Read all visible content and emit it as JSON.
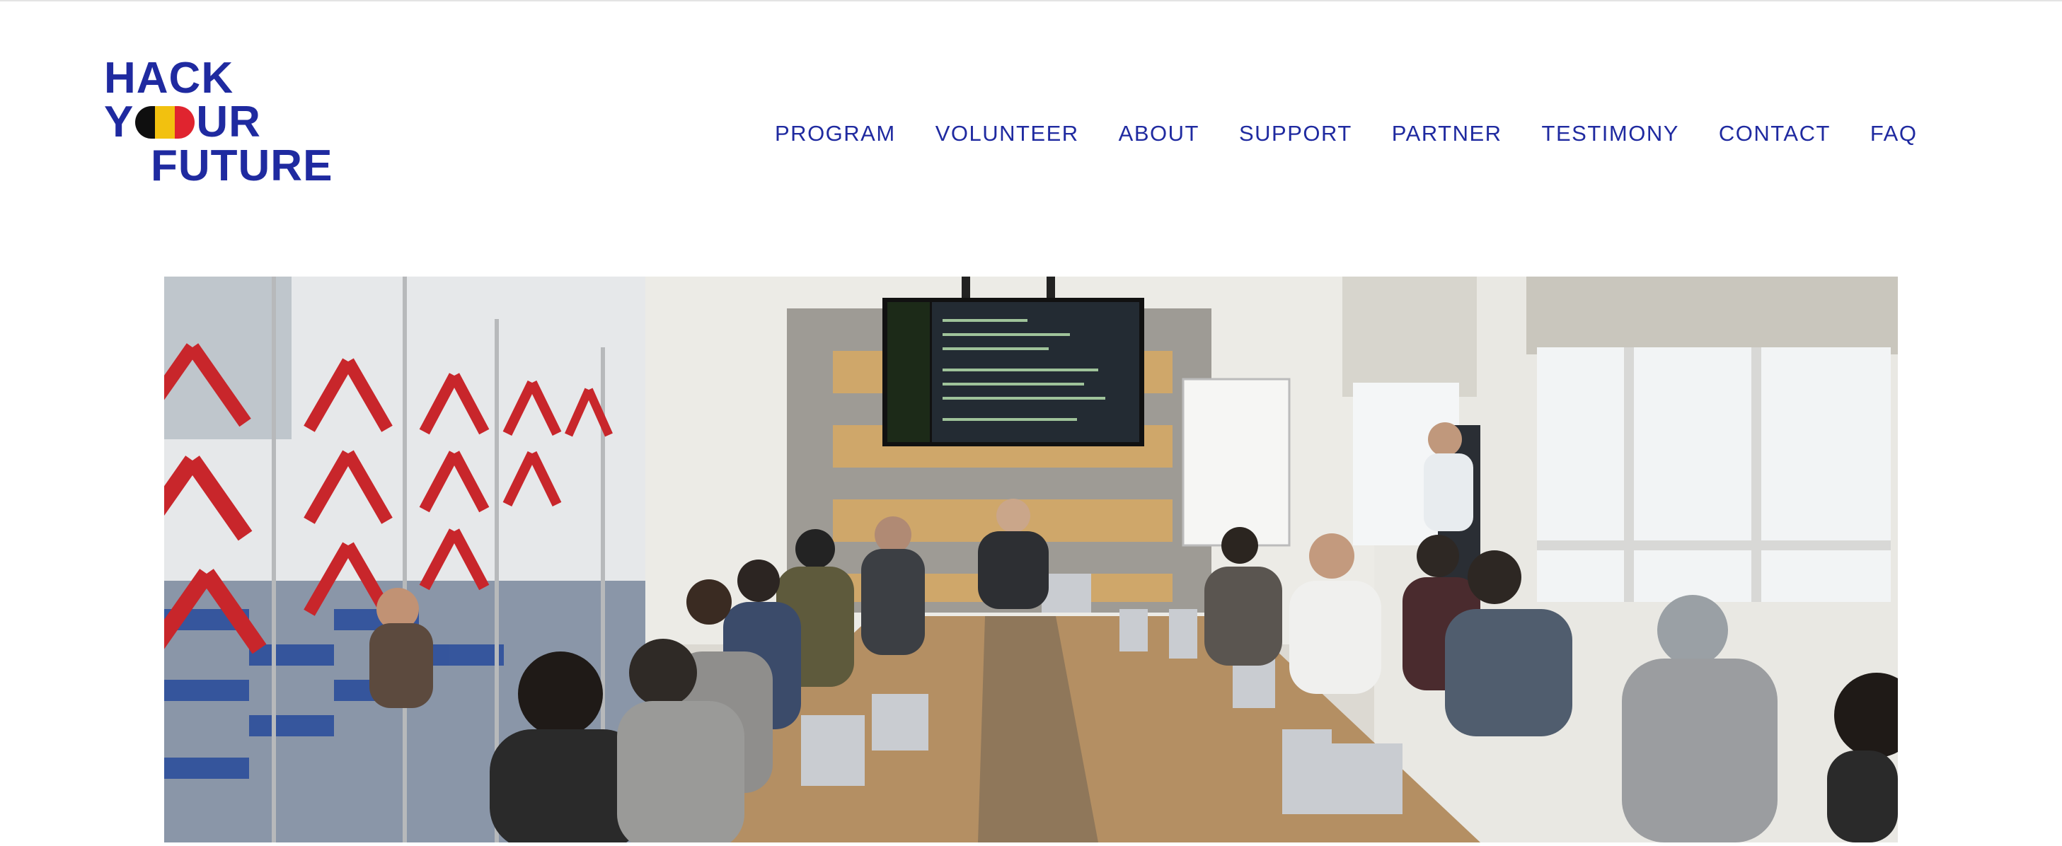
{
  "logo": {
    "line1": "HACK",
    "line2_start": "Y",
    "line2_end": "UR",
    "line3": "FUTURE",
    "flag_colors": [
      "#0f0f0f",
      "#f2c10f",
      "#e0242f"
    ],
    "brand_color": "#1f2aa0"
  },
  "nav": {
    "items": [
      {
        "label": "PROGRAM"
      },
      {
        "label": "VOLUNTEER"
      },
      {
        "label": "ABOUT"
      },
      {
        "label": "SUPPORT"
      },
      {
        "label": "PARTNER"
      },
      {
        "label": "TESTIMONY"
      },
      {
        "label": "CONTACT"
      },
      {
        "label": "FAQ"
      }
    ]
  },
  "hero": {
    "subject": "classroom-photo"
  }
}
